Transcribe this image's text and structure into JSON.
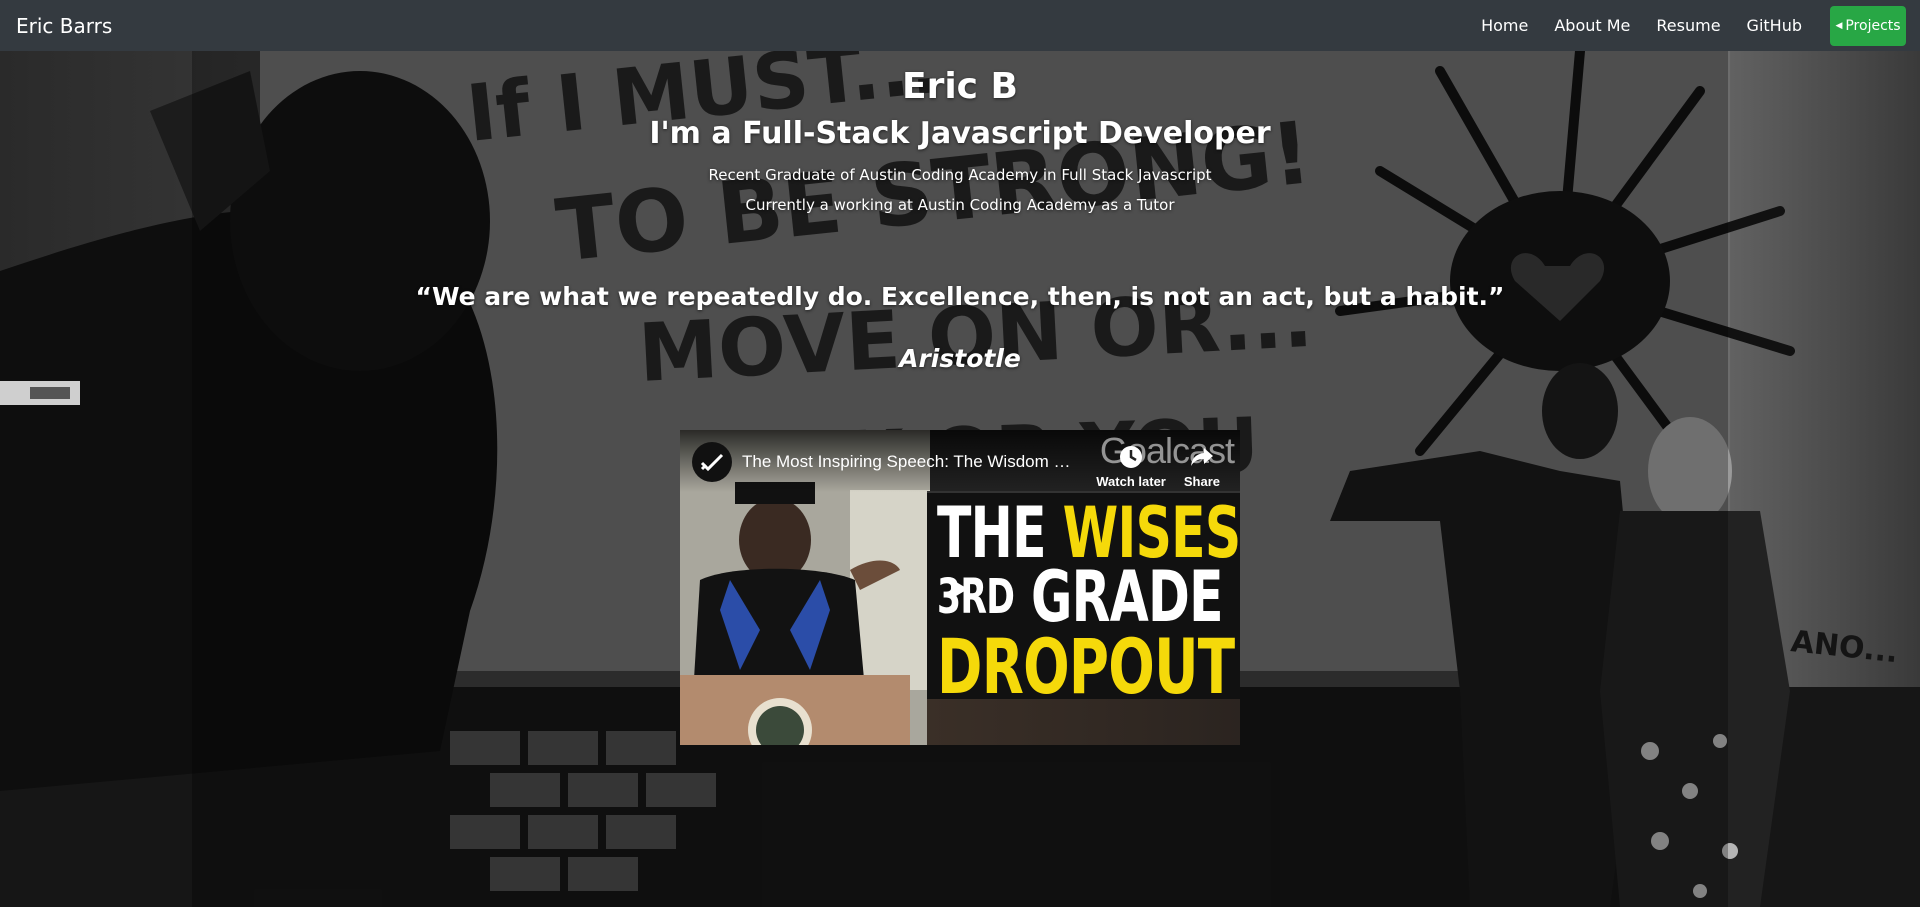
{
  "navbar": {
    "brand": "Eric Barrs",
    "links": [
      "Home",
      "About Me",
      "Resume",
      "GitHub"
    ],
    "projects_label": "Projects",
    "projects_color": "#28a745",
    "background": "#343a40"
  },
  "hero": {
    "name": "Eric B",
    "role": "I'm a Full-Stack Javascript Developer",
    "line1": "Recent Graduate of Austin Coding Academy in Full Stack Javascript",
    "line2": "Currently a working at Austin Coding Academy as a Tutor",
    "quote": "“We are what we repeatedly do. Excellence, then, is not an act, but a habit.”",
    "author": "Aristotle"
  },
  "video": {
    "title": "The Most Inspiring Speech: The Wisdom …",
    "channel_watermark": "Goalcast",
    "watch_later": "Watch later",
    "share": "Share",
    "thumbnail_text": {
      "line1_white": "THE",
      "line1_yellow": "WISEST",
      "line2_ordinal": "3RD",
      "line2_word": "GRADE",
      "line3": "DROPOUT"
    },
    "thumbnail_yellow": "#f5d90a"
  },
  "background": {
    "wall_text": [
      "If I Must...",
      "TO BE STRONG!",
      "MOVE ON OR...",
      "SINK OR YOU..."
    ],
    "side_text": "ANO..."
  }
}
